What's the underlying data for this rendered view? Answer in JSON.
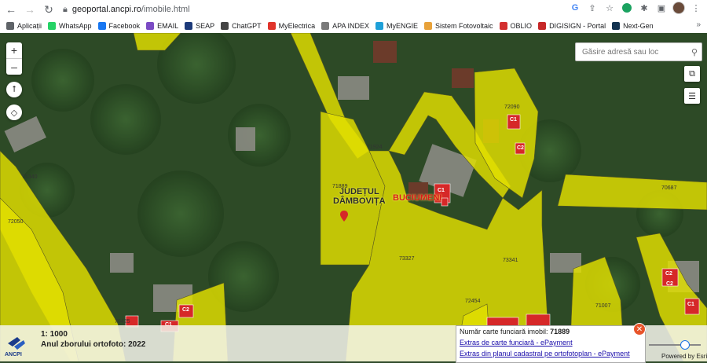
{
  "browser": {
    "url_host": "geoportal.ancpi.ro",
    "url_path": "/imobile.html"
  },
  "bookmarks": [
    {
      "label": "Aplicații",
      "color": "#5f6368"
    },
    {
      "label": "WhatsApp",
      "color": "#25d366"
    },
    {
      "label": "Facebook",
      "color": "#1877f2"
    },
    {
      "label": "EMAIL",
      "color": "#7b4bc4"
    },
    {
      "label": "SEAP",
      "color": "#1d3a7a"
    },
    {
      "label": "ChatGPT",
      "color": "#444444"
    },
    {
      "label": "MyElectrica",
      "color": "#e0342b"
    },
    {
      "label": "APA INDEX",
      "color": "#7a7a7a"
    },
    {
      "label": "MyENGIE",
      "color": "#1ea0d8"
    },
    {
      "label": "Sistem Fotovoltaic",
      "color": "#e8a23a"
    },
    {
      "label": "OBLIO",
      "color": "#d32f2f"
    },
    {
      "label": "DIGISIGN - Portal",
      "color": "#c62828"
    },
    {
      "label": "Next-Gen",
      "color": "#12324f"
    }
  ],
  "bookmarks_more": "»",
  "map": {
    "search_placeholder": "Găsire adresă sau loc",
    "zoom_in": "+",
    "zoom_out": "–",
    "uat_label_line1": "JUDEȚUL",
    "uat_label_line2": "DÂMBOVIȚA",
    "uat_label_red": "BUCIUMENI",
    "parcels": [
      "72090",
      "71924",
      "71889",
      "72050",
      "71340",
      "73327",
      "73341",
      "70687",
      "72454",
      "71007",
      "70425"
    ],
    "stamps": [
      "C1",
      "C2",
      "C1",
      "C2",
      "C1",
      "C2",
      "C2",
      "C1"
    ]
  },
  "bottom": {
    "scale": "1: 1000",
    "flight_year": "Anul zborului ortofoto: 2022",
    "cf_label": "Număr carte funciară imobil:",
    "cf_number": "71889",
    "link1": "Extras de carte funciară - ePayment",
    "link2": "Extras din planul cadastral pe ortofotoplan - ePayment",
    "close": "✕",
    "powered": "Powered by Esri",
    "logo_text": "ANCPI"
  }
}
